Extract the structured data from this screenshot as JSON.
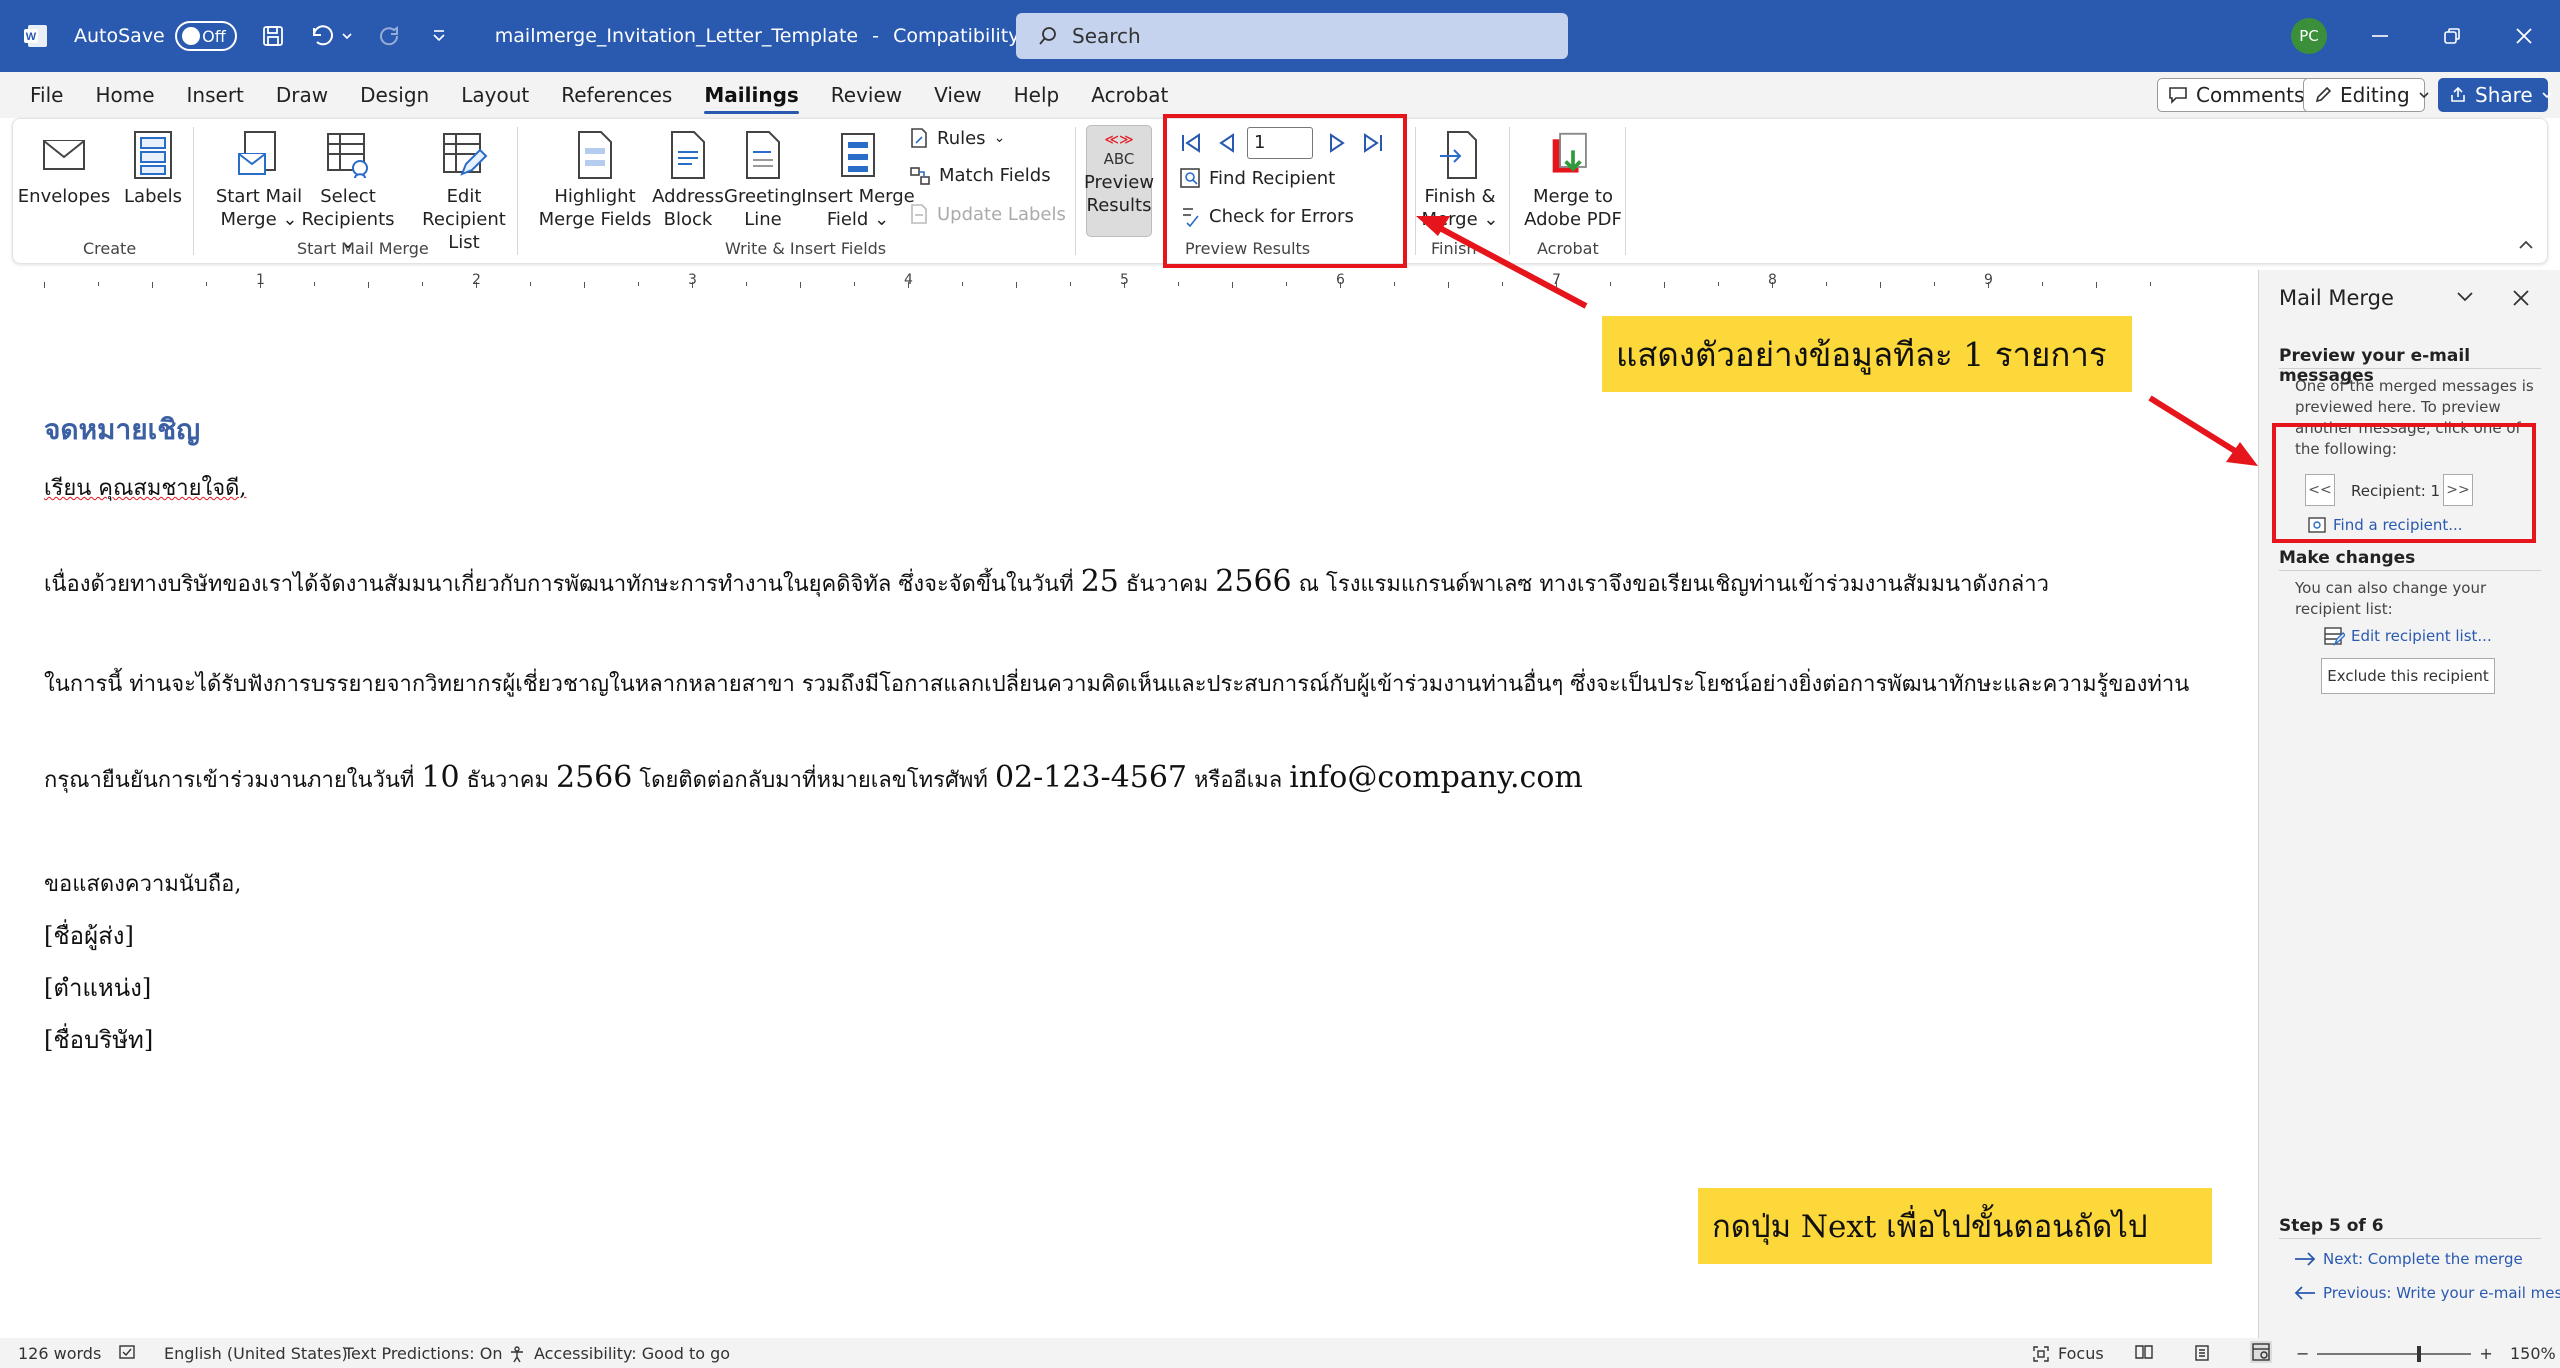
{
  "titlebar": {
    "autosave_label": "AutoSave",
    "autosave_state": "Off",
    "filename": "mailmerge_Invitation_Letter_Template",
    "separator": "-",
    "mode": "Compatibility Mode",
    "search_placeholder": "Search",
    "avatar_initials": "PC"
  },
  "menu": {
    "tabs": [
      "File",
      "Home",
      "Insert",
      "Draw",
      "Design",
      "Layout",
      "References",
      "Mailings",
      "Review",
      "View",
      "Help",
      "Acrobat"
    ],
    "active": "Mailings",
    "comments": "Comments",
    "editing": "Editing",
    "share": "Share"
  },
  "ribbon": {
    "envelopes": "Envelopes",
    "labels": "Labels",
    "create_group": "Create",
    "start_mail_merge_1": "Start Mail",
    "start_mail_merge_2": "Merge",
    "select_recipients_1": "Select",
    "select_recipients_2": "Recipients",
    "edit_recipient_list_1": "Edit",
    "edit_recipient_list_2": "Recipient List",
    "start_group": "Start Mail Merge",
    "highlight_1": "Highlight",
    "highlight_2": "Merge Fields",
    "address_1": "Address",
    "address_2": "Block",
    "greeting_1": "Greeting",
    "greeting_2": "Line",
    "insert_field_1": "Insert Merge",
    "insert_field_2": "Field",
    "rules": "Rules",
    "match_fields": "Match Fields",
    "update_labels": "Update Labels",
    "write_group": "Write & Insert Fields",
    "preview_abc": "ABC",
    "preview_1": "Preview",
    "preview_2": "Results",
    "record_number": "1",
    "find_recipient": "Find Recipient",
    "check_errors": "Check for Errors",
    "preview_group": "Preview Results",
    "finish_1": "Finish &",
    "finish_2": "Merge",
    "finish_group": "Finish",
    "merge_pdf_1": "Merge to",
    "merge_pdf_2": "Adobe PDF",
    "acrobat_group": "Acrobat"
  },
  "ruler": {
    "numbers": [
      "1",
      "2",
      "3",
      "4",
      "5",
      "6",
      "7",
      "8",
      "9"
    ]
  },
  "document": {
    "title": "จดหมายเชิญ",
    "salutation": "เรียน คุณสมชายใจดี,",
    "p1_a": "เนื่องด้วยทางบริษัทของเราได้จัดงานสัมมนาเกี่ยวกับการพัฒนาทักษะการทำงานในยุคดิจิทัล ซึ่งจะจัดขึ้นในวันที่",
    "p1_n1": "25",
    "p1_b": "ธันวาคม",
    "p1_n2": "2566",
    "p1_c": "ณ โรงแรมแกรนด์พาเลซ ทางเราจึงขอเรียนเชิญท่านเข้าร่วมงานสัมมนาดังกล่าว",
    "p2": "ในการนี้ ท่านจะได้รับฟังการบรรยายจากวิทยากรผู้เชี่ยวชาญในหลากหลายสาขา รวมถึงมีโอกาสแลกเปลี่ยนความคิดเห็นและประสบการณ์กับผู้เข้าร่วมงานท่านอื่นๆ ซึ่งจะเป็นประโยชน์อย่างยิ่งต่อการพัฒนาทักษะและความรู้ของท่าน",
    "p3_a": "กรุณายืนยันการเข้าร่วมงานภายในวันที่",
    "p3_n1": "10",
    "p3_b": "ธันวาคม",
    "p3_n2": "2566",
    "p3_c": "โดยติดต่อกลับมาที่หมายเลขโทรศัพท์",
    "p3_phone": "02-123-4567",
    "p3_d": "หรืออีเมล",
    "p3_email": "info@company.com",
    "closing": "ขอแสดงความนับถือ,",
    "sender": "[ชื่อผู้ส่ง]",
    "position": "[ตำแหน่ง]",
    "company": "[ชื่อบริษัท]"
  },
  "callouts": {
    "top": "แสดงตัวอย่างข้อมูลทีละ 1 รายการ",
    "bottom": "กดปุ่ม Next เพื่อไปขั้นตอนถัดไป",
    "color": "#fcd83a",
    "highlight_color": "#e5151b"
  },
  "pane": {
    "title": "Mail Merge",
    "preview_heading": "Preview your e-mail messages",
    "preview_text": "One of the merged messages is previewed here. To preview another message, click one of the following:",
    "prev_btn": "<<",
    "recipient_label": "Recipient: 1",
    "next_btn": ">>",
    "find_link": "Find a recipient...",
    "changes_heading": "Make changes",
    "changes_text": "You can also change your recipient list:",
    "edit_link": "Edit recipient list...",
    "exclude_btn": "Exclude this recipient",
    "step": "Step 5 of 6",
    "next_link": "Next: Complete the merge",
    "prev_link": "Previous: Write your e-mail mess"
  },
  "status": {
    "words": "126 words",
    "language": "English (United States)",
    "predictions": "Text Predictions: On",
    "accessibility": "Accessibility: Good to go",
    "focus": "Focus",
    "zoom": "150%"
  }
}
